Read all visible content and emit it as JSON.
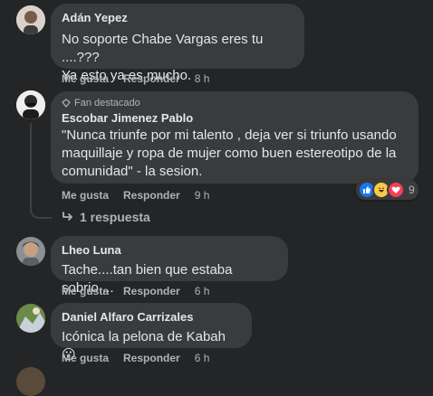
{
  "comments": [
    {
      "author": "Adán Yepez",
      "lines": [
        "No soporte Chabe Vargas eres tu ....???",
        "Ya esto ya es mucho."
      ],
      "like": "Me gusta",
      "reply": "Responder",
      "time": "8 h"
    },
    {
      "badge": "Fan destacado",
      "author": "Escobar Jimenez Pablo",
      "lines": [
        "\"Nunca triunfe por mi talento , deja ver si triunfo usando",
        "maquillaje y ropa de mujer como buen estereotipo de la",
        "comunidad\" - la sesion."
      ],
      "like": "Me gusta",
      "reply": "Responder",
      "time": "9 h",
      "reaction_count": "9",
      "reactions": [
        "like-icon",
        "laugh-emoji-icon",
        "heart-icon"
      ],
      "replies_label": "1 respuesta"
    },
    {
      "author": "Lheo Luna",
      "lines": [
        "Tache....tan bien que estaba sobrio...."
      ],
      "like": "Me gusta",
      "reply": "Responder",
      "time": "6 h"
    },
    {
      "author": "Daniel Alfaro Carrizales",
      "lines": [
        "Icónica la pelona de Kabah 😮"
      ],
      "like": "Me gusta",
      "reply": "Responder",
      "time": "6 h"
    }
  ],
  "colors": {
    "background": "#242526",
    "bubble": "#3a3b3c",
    "text": "#e4e6eb",
    "muted": "#b0b3b8",
    "like": "#1877f2",
    "heart": "#f33e58"
  }
}
